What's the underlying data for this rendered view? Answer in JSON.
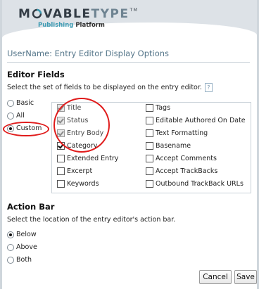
{
  "brand": {
    "logo_m": "M",
    "logo_vable": "VABLE",
    "logo_type": "TYPE",
    "logo_tm": "TM",
    "subtitle_part1": "Publishing",
    "subtitle_part2": "Platform"
  },
  "page_title": "UserName: Entry Editor Display Options",
  "editor_fields": {
    "heading": "Editor Fields",
    "description": "Select the set of fields to be displayed on the entry editor.",
    "help_label": "?",
    "modes": [
      {
        "label": "Basic",
        "selected": false
      },
      {
        "label": "All",
        "selected": false
      },
      {
        "label": "Custom",
        "selected": true
      }
    ],
    "fields_left": [
      {
        "label": "Title",
        "checked": true,
        "disabled": true
      },
      {
        "label": "Status",
        "checked": true,
        "disabled": true
      },
      {
        "label": "Entry Body",
        "checked": true,
        "disabled": true
      },
      {
        "label": "Category",
        "checked": true,
        "disabled": false
      },
      {
        "label": "Extended Entry",
        "checked": false,
        "disabled": false
      },
      {
        "label": "Excerpt",
        "checked": false,
        "disabled": false
      },
      {
        "label": "Keywords",
        "checked": false,
        "disabled": false
      }
    ],
    "fields_right": [
      {
        "label": "Tags",
        "checked": false,
        "disabled": false
      },
      {
        "label": "Editable Authored On Date",
        "checked": false,
        "disabled": false
      },
      {
        "label": "Text Formatting",
        "checked": false,
        "disabled": false
      },
      {
        "label": "Basename",
        "checked": false,
        "disabled": false
      },
      {
        "label": "Accept Comments",
        "checked": false,
        "disabled": false
      },
      {
        "label": "Accept TrackBacks",
        "checked": false,
        "disabled": false
      },
      {
        "label": "Outbound TrackBack URLs",
        "checked": false,
        "disabled": false
      }
    ]
  },
  "action_bar": {
    "heading": "Action Bar",
    "description": "Select the location of the entry editor's action bar.",
    "options": [
      {
        "label": "Below",
        "selected": true
      },
      {
        "label": "Above",
        "selected": false
      },
      {
        "label": "Both",
        "selected": false
      }
    ]
  },
  "buttons": {
    "cancel": "Cancel",
    "save": "Save"
  },
  "colors": {
    "annotation": "#e01b1b",
    "title_text": "#55768a",
    "header_bg": "#dde2e7"
  }
}
